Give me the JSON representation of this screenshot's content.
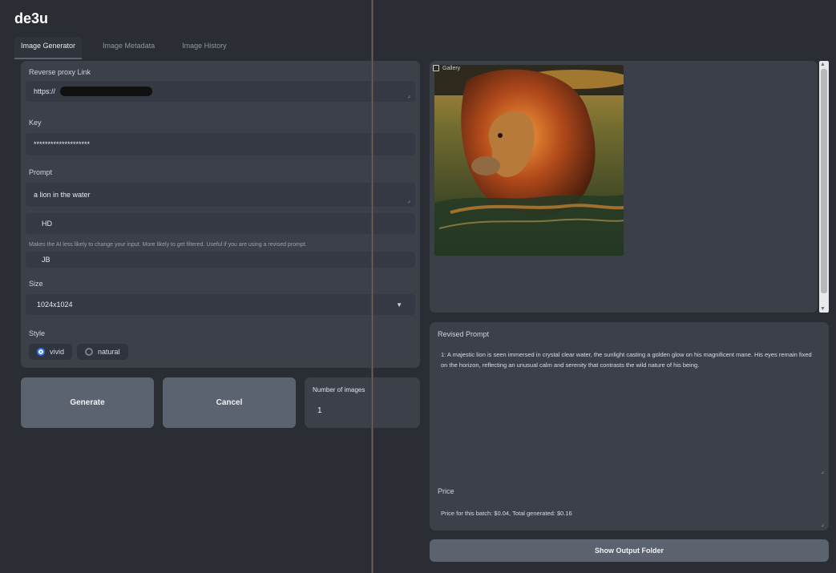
{
  "app": {
    "title": "de3u"
  },
  "tabs": [
    {
      "label": "Image Generator",
      "active": true
    },
    {
      "label": "Image Metadata",
      "active": false
    },
    {
      "label": "Image History",
      "active": false
    }
  ],
  "form": {
    "proxy": {
      "label": "Reverse proxy Link",
      "value": "https://"
    },
    "key": {
      "label": "Key",
      "value": "********************"
    },
    "prompt": {
      "label": "Prompt",
      "value": "a lion in the water"
    },
    "quality": {
      "value": "HD"
    },
    "hint": "Makes the AI less likely to change your input. More likely to get filtered. Useful if you are using a revised prompt.",
    "field_jb": {
      "value": "JB"
    },
    "size": {
      "label": "Size",
      "value": "1024x1024"
    },
    "style": {
      "label": "Style",
      "options": [
        {
          "label": "vivid",
          "selected": true
        },
        {
          "label": "natural",
          "selected": false
        }
      ]
    }
  },
  "buttons": {
    "generate": "Generate",
    "cancel": "Cancel",
    "show_output_folder": "Show Output Folder"
  },
  "number_of_images": {
    "label": "Number of images",
    "value": "1"
  },
  "gallery": {
    "label": "Gallery"
  },
  "revised_prompt": {
    "label": "Revised Prompt",
    "text": "1: A majestic lion is seen immersed in crystal clear water, the sunlight casting a golden glow on his magnificent mane. His eyes remain fixed on the horizon, reflecting an unusual calm and serenity that contrasts the wild nature of his being."
  },
  "price": {
    "label": "Price",
    "text": "Price for this batch: $0.04, Total generated: $0.16"
  },
  "colors": {
    "accent": "#2f78e8",
    "panel": "#3b4049",
    "button": "#5c6370",
    "background": "#2a2d33"
  },
  "icons": {
    "gallery": "image-icon",
    "dropdown": "chevron-down-icon",
    "resize": "resize-handle-icon"
  }
}
